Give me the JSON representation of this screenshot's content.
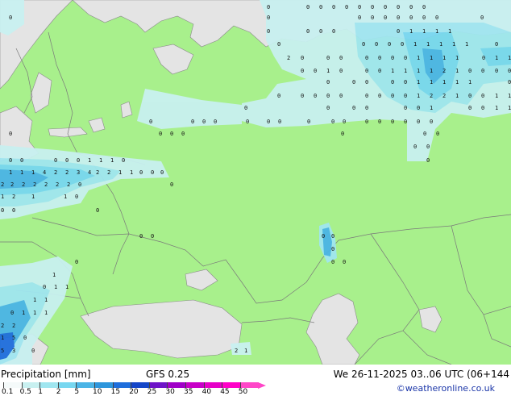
{
  "footer": {
    "legend_title": "Precipitation [mm]",
    "model": "GFS 0.25",
    "valid_time": "We 26-11-2025 03..06 UTC (06+144",
    "credit": "©weatheronline.co.uk"
  },
  "legend": {
    "ticks": [
      "0.1",
      "0.5",
      "1",
      "2",
      "5",
      "10",
      "15",
      "20",
      "25",
      "30",
      "35",
      "40",
      "45",
      "50"
    ],
    "colors": [
      "#f5fafa",
      "#c8f0f0",
      "#a0e6f0",
      "#78d7f0",
      "#4bb4e6",
      "#2d96dc",
      "#1e6edc",
      "#1446c8",
      "#6e14c8",
      "#a000c8",
      "#c800c8",
      "#e600c8",
      "#ff00c8",
      "#ff46c8"
    ]
  },
  "map": {
    "colors": {
      "land": "#a8f08c",
      "sea": "#e4e4e4",
      "border": "#7a7a7a",
      "precip_light": "#c8f0f0",
      "precip_mid": "#a0e6f0",
      "precip_strong": "#78d7f0",
      "precip_heavy": "#4bb4e6",
      "precip_max": "#1e6edc"
    },
    "labels": [
      [
        "0",
        330,
        8
      ],
      [
        "0",
        379,
        8
      ],
      [
        "0",
        395,
        8
      ],
      [
        "0",
        411,
        8
      ],
      [
        "0",
        427,
        8
      ],
      [
        "0",
        443,
        8
      ],
      [
        "0",
        459,
        8
      ],
      [
        "0",
        475,
        8
      ],
      [
        "0",
        491,
        8
      ],
      [
        "0",
        507,
        8
      ],
      [
        "0",
        523,
        8
      ],
      [
        "0",
        10,
        21
      ],
      [
        "0",
        330,
        21
      ],
      [
        "0",
        443,
        21
      ],
      [
        "0",
        459,
        21
      ],
      [
        "0",
        475,
        21
      ],
      [
        "0",
        491,
        21
      ],
      [
        "0",
        507,
        21
      ],
      [
        "0",
        523,
        21
      ],
      [
        "0",
        539,
        21
      ],
      [
        "0",
        595,
        21
      ],
      [
        "0",
        330,
        38
      ],
      [
        "0",
        379,
        38
      ],
      [
        "0",
        395,
        38
      ],
      [
        "0",
        411,
        38
      ],
      [
        "0",
        491,
        38
      ],
      [
        "1",
        507,
        38
      ],
      [
        "1",
        523,
        38
      ],
      [
        "1",
        539,
        38
      ],
      [
        "1",
        555,
        38
      ],
      [
        "0",
        343,
        54
      ],
      [
        "0",
        448,
        54
      ],
      [
        "0",
        464,
        54
      ],
      [
        "0",
        480,
        54
      ],
      [
        "0",
        496,
        54
      ],
      [
        "1",
        512,
        54
      ],
      [
        "1",
        528,
        54
      ],
      [
        "1",
        544,
        54
      ],
      [
        "1",
        560,
        54
      ],
      [
        "1",
        576,
        54
      ],
      [
        "0",
        613,
        54
      ],
      [
        "2",
        355,
        71
      ],
      [
        "0",
        372,
        71
      ],
      [
        "0",
        404,
        71
      ],
      [
        "0",
        420,
        71
      ],
      [
        "0",
        452,
        71
      ],
      [
        "0",
        468,
        71
      ],
      [
        "0",
        484,
        71
      ],
      [
        "0",
        500,
        71
      ],
      [
        "1",
        516,
        71
      ],
      [
        "1",
        532,
        71
      ],
      [
        "1",
        548,
        71
      ],
      [
        "1",
        564,
        71
      ],
      [
        "0",
        597,
        71
      ],
      [
        "1",
        613,
        71
      ],
      [
        "1",
        629,
        71
      ],
      [
        "0",
        372,
        87
      ],
      [
        "0",
        388,
        87
      ],
      [
        "1",
        404,
        87
      ],
      [
        "0",
        420,
        87
      ],
      [
        "0",
        452,
        87
      ],
      [
        "0",
        468,
        87
      ],
      [
        "1",
        484,
        87
      ],
      [
        "1",
        500,
        87
      ],
      [
        "1",
        516,
        87
      ],
      [
        "1",
        532,
        87
      ],
      [
        "2",
        548,
        87
      ],
      [
        "1",
        564,
        87
      ],
      [
        "0",
        580,
        87
      ],
      [
        "0",
        596,
        87
      ],
      [
        "0",
        613,
        87
      ],
      [
        "0",
        629,
        87
      ],
      [
        "0",
        404,
        101
      ],
      [
        "0",
        436,
        101
      ],
      [
        "0",
        452,
        101
      ],
      [
        "0",
        484,
        101
      ],
      [
        "0",
        500,
        101
      ],
      [
        "1",
        516,
        101
      ],
      [
        "1",
        532,
        101
      ],
      [
        "1",
        548,
        101
      ],
      [
        "1",
        564,
        101
      ],
      [
        "1",
        580,
        101
      ],
      [
        "0",
        629,
        101
      ],
      [
        "0",
        343,
        118
      ],
      [
        "0",
        372,
        118
      ],
      [
        "0",
        388,
        118
      ],
      [
        "0",
        404,
        118
      ],
      [
        "0",
        420,
        118
      ],
      [
        "0",
        452,
        118
      ],
      [
        "0",
        468,
        118
      ],
      [
        "0",
        484,
        118
      ],
      [
        "0",
        500,
        118
      ],
      [
        "1",
        516,
        118
      ],
      [
        "2",
        532,
        118
      ],
      [
        "2",
        548,
        118
      ],
      [
        "1",
        564,
        118
      ],
      [
        "0",
        580,
        118
      ],
      [
        "0",
        596,
        118
      ],
      [
        "1",
        613,
        118
      ],
      [
        "1",
        629,
        118
      ],
      [
        "0",
        302,
        133
      ],
      [
        "0",
        404,
        133
      ],
      [
        "0",
        436,
        133
      ],
      [
        "0",
        452,
        133
      ],
      [
        "0",
        500,
        133
      ],
      [
        "0",
        516,
        133
      ],
      [
        "1",
        532,
        133
      ],
      [
        "0",
        580,
        133
      ],
      [
        "0",
        596,
        133
      ],
      [
        "1",
        613,
        133
      ],
      [
        "1",
        629,
        133
      ],
      [
        "0",
        184,
        150
      ],
      [
        "0",
        236,
        150
      ],
      [
        "0",
        250,
        150
      ],
      [
        "0",
        264,
        150
      ],
      [
        "0",
        304,
        150
      ],
      [
        "0",
        330,
        150
      ],
      [
        "0",
        344,
        150
      ],
      [
        "0",
        380,
        150
      ],
      [
        "0",
        410,
        150
      ],
      [
        "0",
        424,
        150
      ],
      [
        "0",
        452,
        150
      ],
      [
        "0",
        468,
        150
      ],
      [
        "0",
        484,
        150
      ],
      [
        "0",
        500,
        150
      ],
      [
        "0",
        516,
        150
      ],
      [
        "0",
        532,
        150
      ],
      [
        "0",
        10,
        165
      ],
      [
        "0",
        196,
        165
      ],
      [
        "0",
        210,
        165
      ],
      [
        "0",
        224,
        165
      ],
      [
        "0",
        422,
        165
      ],
      [
        "0",
        524,
        165
      ],
      [
        "0",
        540,
        165
      ],
      [
        "0",
        512,
        181
      ],
      [
        "0",
        528,
        181
      ],
      [
        "0",
        10,
        198
      ],
      [
        "0",
        24,
        198
      ],
      [
        "0",
        66,
        198
      ],
      [
        "0",
        80,
        198
      ],
      [
        "0",
        94,
        198
      ],
      [
        "1",
        108,
        198
      ],
      [
        "1",
        122,
        198
      ],
      [
        "1",
        136,
        198
      ],
      [
        "0",
        150,
        198
      ],
      [
        "0",
        528,
        198
      ],
      [
        "1",
        10,
        213
      ],
      [
        "1",
        24,
        213
      ],
      [
        "1",
        38,
        213
      ],
      [
        "4",
        52,
        213
      ],
      [
        "2",
        66,
        213
      ],
      [
        "2",
        80,
        213
      ],
      [
        "3",
        94,
        213
      ],
      [
        "4",
        108,
        213
      ],
      [
        "2",
        118,
        213
      ],
      [
        "2",
        132,
        213
      ],
      [
        "1",
        146,
        213
      ],
      [
        "1",
        160,
        213
      ],
      [
        "0",
        172,
        213
      ],
      [
        "0",
        186,
        213
      ],
      [
        "0",
        198,
        213
      ],
      [
        "2",
        0,
        228
      ],
      [
        "2",
        12,
        228
      ],
      [
        "2",
        26,
        228
      ],
      [
        "2",
        40,
        228
      ],
      [
        "2",
        54,
        228
      ],
      [
        "2",
        68,
        228
      ],
      [
        "2",
        82,
        228
      ],
      [
        "0",
        96,
        228
      ],
      [
        "0",
        210,
        228
      ],
      [
        "1",
        0,
        243
      ],
      [
        "2",
        14,
        243
      ],
      [
        "1",
        38,
        243
      ],
      [
        "1",
        78,
        243
      ],
      [
        "0",
        92,
        243
      ],
      [
        "0",
        0,
        260
      ],
      [
        "0",
        14,
        260
      ],
      [
        "0",
        118,
        260
      ],
      [
        "0",
        172,
        292
      ],
      [
        "0",
        186,
        292
      ],
      [
        "0",
        398,
        292
      ],
      [
        "0",
        410,
        292
      ],
      [
        "0",
        410,
        308
      ],
      [
        "0",
        92,
        324
      ],
      [
        "0",
        410,
        324
      ],
      [
        "0",
        424,
        324
      ],
      [
        "1",
        64,
        340
      ],
      [
        "0",
        52,
        355
      ],
      [
        "1",
        66,
        355
      ],
      [
        "1",
        80,
        355
      ],
      [
        "1",
        40,
        371
      ],
      [
        "1",
        54,
        371
      ],
      [
        "0",
        12,
        387
      ],
      [
        "1",
        26,
        387
      ],
      [
        "1",
        40,
        387
      ],
      [
        "1",
        54,
        387
      ],
      [
        "2",
        0,
        403
      ],
      [
        "2",
        14,
        403
      ],
      [
        "1",
        0,
        418
      ],
      [
        "5",
        14,
        418
      ],
      [
        "0",
        28,
        418
      ],
      [
        "5",
        0,
        434
      ],
      [
        "3",
        14,
        434
      ],
      [
        "0",
        38,
        434
      ],
      [
        "2",
        290,
        434
      ],
      [
        "1",
        302,
        434
      ]
    ]
  }
}
